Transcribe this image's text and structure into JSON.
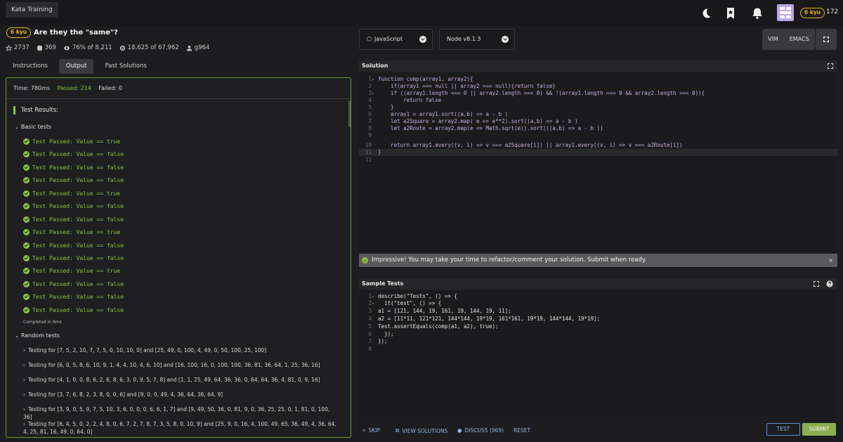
{
  "header": {
    "app_title": "Kata Training",
    "user_rank": "6 kyu",
    "honor": "172"
  },
  "kata": {
    "rank": "6 kyu",
    "title": "Are they the \"same\"?",
    "stats": {
      "stars": "2737",
      "collections": "369",
      "satisfaction": "76% of 8,211",
      "completed": "18,625 of 67,962",
      "author": "g964"
    }
  },
  "left_tabs": [
    "Instructions",
    "Output",
    "Past Solutions"
  ],
  "output": {
    "time": "Time: 780ms",
    "passed": "Passed: 214",
    "failed": "Failed: 0",
    "test_results_label": "Test Results:",
    "basic_tests_label": "Basic tests",
    "passes": [
      "Test Passed: Value == true",
      "Test Passed: Value == false",
      "Test Passed: Value == false",
      "Test Passed: Value == false",
      "Test Passed: Value == true",
      "Test Passed: Value == false",
      "Test Passed: Value == false",
      "Test Passed: Value == true",
      "Test Passed: Value == false",
      "Test Passed: Value == false",
      "Test Passed: Value == true",
      "Test Passed: Value == false",
      "Test Passed: Value == false",
      "Test Passed: Value == false"
    ],
    "completed_in": "Completed in 8ms",
    "random_tests_label": "Random tests",
    "random_tests": [
      "Testing for [7, 5, 2, 10, 7, 7, 5, 0, 10, 10, 0] and [25, 49, 0, 100, 4, 49, 0, 50, 100, 25, 100]",
      "Testing for [6, 0, 5, 8, 6, 10, 9, 1, 4, 4, 10, 4, 6, 10] and [16, 100, 16, 0, 100, 100, 36, 81, 36, 64, 1, 25, 36, 16]",
      "Testing for [4, 1, 0, 0, 8, 6, 2, 6, 8, 6, 3, 0, 9, 5, 7, 8] and [1, 1, 25, 49, 64, 36, 36, 0, 64, 64, 36, 4, 81, 0, 9, 16]",
      "Testing for [3, 7, 6, 8, 2, 3, 8, 0, 0, 6] and [9, 0, 0, 49, 4, 36, 64, 36, 64, 9]",
      "Testing for [3, 9, 0, 5, 9, 7, 5, 10, 3, 6, 0, 0, 0, 6, 6, 1, 7] and [9, 49, 50, 36, 0, 81, 9, 0, 36, 25, 25, 0, 1, 81, 0, 100, 36]",
      "Testing for [6, 4, 5, 0, 2, 2, 4, 8, 0, 6, 7, 2, 7, 8, 7, 3, 5, 8, 0, 10, 9] and [25, 9, 0, 16, 4, 100, 49, 65, 36, 49, 4, 36, 64, 4, 25, 81, 16, 49, 0, 64, 0]"
    ]
  },
  "toolbar": {
    "language": "JavaScript",
    "runtime": "Node v8.1.3",
    "modes": [
      "VIM",
      "EMACS"
    ]
  },
  "solution": {
    "title": "Solution",
    "lines": [
      "function comp(array1, array2){",
      "    if(array1 === null || array2 === null){return false}",
      "    if ((array1.length === 0 || array2.length === 0) && !(array1.length === 0 && array2.length === 0)){",
      "        return false",
      "    }",
      "    array1 = array1.sort((a,b) => a - b )",
      "    let a2Square = array2.map( e => e**2).sort((a,b) => a - b )",
      "    let a2Route = array2.map(e => Math.sqrt(e)).sort(((a,b) => a - b ))",
      "",
      "    return array1.every((v, i) => v === a2Square[i]) || array1.every((v, i) => v === a2Route[i])",
      "}",
      ""
    ]
  },
  "banner": {
    "message": "Impressive! You may take your time to refactor/comment your solution. Submit when ready.",
    "close": "×"
  },
  "sample_tests": {
    "title": "Sample Tests",
    "lines": [
      "describe(\"Tests\", () => {",
      "  it(\"test\", () => {",
      "a1 = [121, 144, 19, 161, 19, 144, 19, 11];",
      "a2 = [11*11, 121*121, 144*144, 19*19, 161*161, 19*19, 144*144, 19*19];",
      "Test.assertEquals(comp(a1, a2), true);",
      "  });",
      "});",
      ""
    ]
  },
  "bottom": {
    "skip": "SKIP",
    "view_solutions": "VIEW SOLUTIONS",
    "discuss": "DISCUSS (969)",
    "reset": "RESET",
    "test": "TEST",
    "submit": "SUBMIT"
  }
}
